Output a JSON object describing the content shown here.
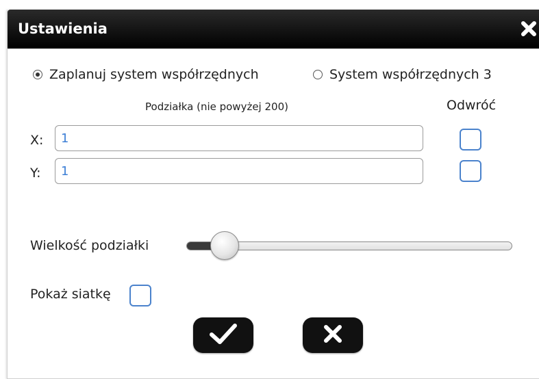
{
  "dialog": {
    "title": "Ustawienia",
    "close_icon": "close-x-icon"
  },
  "coordinate_system": {
    "selected_index": 0,
    "options": [
      {
        "label": "Zaplanuj system współrzędnych",
        "checked": true
      },
      {
        "label": "System współrzędnych 3",
        "checked": false
      }
    ]
  },
  "scale": {
    "header": "Podziałka (nie powyżej 200)",
    "invert_header": "Odwróć",
    "x": {
      "label": "X:",
      "value": "1",
      "invert_checked": false
    },
    "y": {
      "label": "Y:",
      "value": "1",
      "invert_checked": false
    }
  },
  "scale_size": {
    "label": "Wielkość podziałki",
    "slider_fraction": 0.08
  },
  "grid": {
    "label": "Pokaż siatkę",
    "checked": false
  },
  "buttons": {
    "confirm_icon": "checkmark-icon",
    "cancel_icon": "close-icon"
  },
  "colors": {
    "titlebar": "#000000",
    "accent": "#4a82cc",
    "input_text": "#3d7fd6"
  }
}
